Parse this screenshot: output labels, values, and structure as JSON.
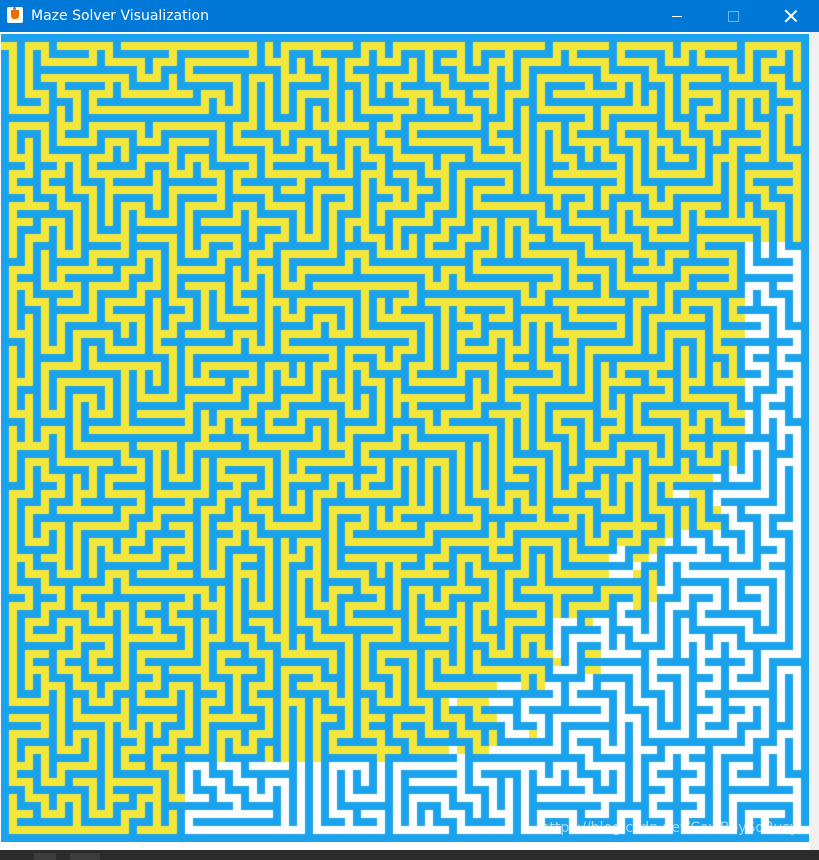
{
  "window": {
    "title": "Maze Solver Visualization",
    "icon": "java-cup-icon",
    "controls": [
      "minimize-icon",
      "maximize-icon",
      "close-icon"
    ]
  },
  "maze": {
    "rows": 101,
    "cols": 101,
    "colors": {
      "wall": "#1aa3ec",
      "visited": "#f5e63b",
      "unvisited": "#ffffff"
    }
  },
  "watermark": "https://blog.csdn.net/CowBoySoBusy"
}
